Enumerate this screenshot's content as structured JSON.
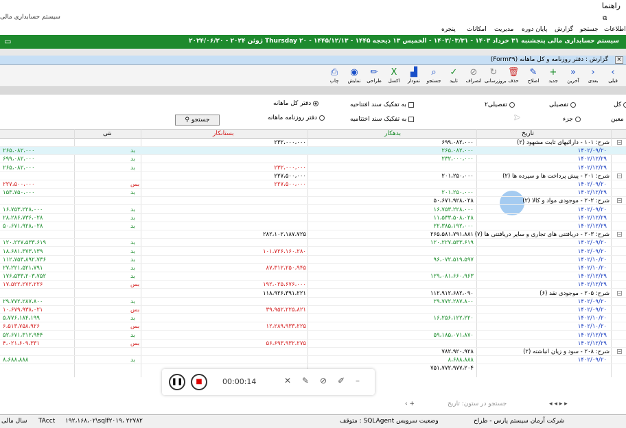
{
  "window": {
    "title": "راهنما",
    "subtitle": "سیستم حسابداری مالی"
  },
  "menu": [
    "اطلاعات",
    "جستجو",
    "گزارش",
    "پایان دوره",
    "مدیریت",
    "امکانات",
    "پنجره"
  ],
  "banner": {
    "text": "سیستم حسابداری مالی   پنجشنبه ۳۱ خرداد ۱۴۰۳ - ۱۴۰۳/۰۳/۳۱ - الخميس ۱۳ ذیحجه ۱۴۴۵ - ۱۴۴۵/۱۲/۱۳ - Thursday ۲۰ ژوئن ۲۰۲۴ - ۲۰۲۴/۰۶/۲۰"
  },
  "form": {
    "title": "گزارش : دفتر روزنامه و کل ماهانه (Form۳۹)"
  },
  "toolbar": [
    {
      "label": "قبلی",
      "icon": "arrow-left-icon",
      "glyph": "‹"
    },
    {
      "label": "بعدی",
      "icon": "arrow-right-icon",
      "glyph": "›"
    },
    {
      "label": "آخرین",
      "icon": "last-icon",
      "glyph": "»"
    },
    {
      "label": "جدید",
      "icon": "plus-icon",
      "glyph": "+"
    },
    {
      "label": "اصلاح",
      "icon": "pencil-icon",
      "glyph": "✎"
    },
    {
      "label": "حذف",
      "icon": "trash-icon",
      "glyph": "🗑"
    },
    {
      "label": "بروزرسانی",
      "icon": "refresh-icon",
      "glyph": "↻"
    },
    {
      "label": "انصراف",
      "icon": "cancel-icon",
      "glyph": "⊘"
    },
    {
      "label": "تایید",
      "icon": "check-icon",
      "glyph": "✓"
    },
    {
      "label": "جستجو",
      "icon": "search-icon",
      "glyph": "⌕"
    },
    {
      "label": "نمودار",
      "icon": "chart-icon",
      "glyph": "▟"
    },
    {
      "label": "اکسل",
      "icon": "excel-icon",
      "glyph": "X"
    },
    {
      "label": "طراحی",
      "icon": "design-icon",
      "glyph": "✏"
    },
    {
      "label": "نمایش",
      "icon": "eye-icon",
      "glyph": "◉"
    },
    {
      "label": "چاپ",
      "icon": "printer-icon",
      "glyph": "⎙"
    }
  ],
  "options": {
    "left_radio_kol": "کل",
    "left_radio_moein": "معین",
    "tafsili": "تفصیلی",
    "tafsili2": "تفصیلی۲",
    "joz": "جزء",
    "cb1": "به تفکیک سند افتتاحیه",
    "cb2": "به تفکیک سند اختتامیه",
    "r1": "دفتر کل ماهانه",
    "r2": "دفتر روزنامه ماهانه",
    "search_btn": "جستجو"
  },
  "headers": {
    "date": "تاریخ",
    "debit": "بدهکار",
    "credit": "بستانکار",
    "nature": "نتی",
    "balance": ""
  },
  "rows": [
    {
      "d": "شرح: ۱۰۱ - دارائیهای ثابت مشهود (۲)",
      "debit": "۶۹۹،۰۸۲،۰۰۰",
      "credit": "۲۳۲،۰۰۰،۰۰۰",
      "nat": "",
      "bal": "",
      "g": true
    },
    {
      "d": "۱۴۰۲/۰۹/۲۰",
      "debit": "۲۶۵،۰۸۲،۰۰۰",
      "credit": "",
      "nat": "بد",
      "bal": "۲۶۵،۰۸۲،۰۰۰",
      "sel": true
    },
    {
      "d": "۱۴۰۲/۱۲/۲۹",
      "debit": "۲۳۲،۰۰۰،۰۰۰",
      "credit": "",
      "nat": "بد",
      "bal": "۶۹۹،۰۸۲،۰۰۰"
    },
    {
      "d": "۱۴۰۲/۱۲/۲۹",
      "debit": "",
      "credit": "۲۳۲،۰۰۰،۰۰۰",
      "nat": "بد",
      "bal": "۲۶۵،۰۸۲،۰۰۰"
    },
    {
      "d": "شرح: ۲۰۱ - پیش پرداخت ها و سپرده ها (۲)",
      "debit": "۲۰۱،۲۵۰،۰۰۰",
      "credit": "۲۲۷،۵۰۰،۰۰۰",
      "nat": "",
      "bal": "",
      "g": true
    },
    {
      "d": "۱۴۰۲/۰۹/۲۰",
      "debit": "",
      "credit": "۲۲۷،۵۰۰،۰۰۰",
      "nat": "بس",
      "bal": "۲۲۷،۵۰۰،۰۰۰",
      "red": true
    },
    {
      "d": "۱۴۰۲/۱۲/۲۹",
      "debit": "۲۰۱،۲۵۰،۰۰۰",
      "credit": "",
      "nat": "بد",
      "bal": "۱۵۳،۷۵۰،۰۰۰"
    },
    {
      "d": "شرح: ۲۰۲ - موجودی مواد و کالا (۲)",
      "debit": "۵۰،۶۷۱،۹۲۸،۰۲۸",
      "credit": "",
      "nat": "",
      "bal": "",
      "g": true
    },
    {
      "d": "۱۴۰۲/۰۹/۲۰",
      "debit": "۱۶،۷۵۳،۲۲۸،۰۰۰",
      "credit": "",
      "nat": "بد",
      "bal": "۱۶،۷۵۳،۲۲۸،۰۰۰"
    },
    {
      "d": "۱۴۰۲/۱۲/۲۹",
      "debit": "۱۱،۵۳۳،۵۰۸،۰۲۸",
      "credit": "",
      "nat": "بد",
      "bal": "۲۸،۲۸۶،۷۳۶،۰۲۸"
    },
    {
      "d": "۱۴۰۲/۱۲/۲۹",
      "debit": "۲۲،۳۸۵،۱۹۲،۰۰۰",
      "credit": "",
      "nat": "بد",
      "bal": "۵۰،۶۷۱،۹۲۸،۰۲۸"
    },
    {
      "d": "شرح: ۲۰۳ - دریافتنی های تجاری و سایر دریافتنی ها (۷)",
      "debit": "۲۶۵،۵۸۱،۷۹۱،۸۸۱",
      "credit": "۲۸۲،۱۰۲،۱۸۷،۷۲۵",
      "nat": "",
      "bal": "",
      "g": true
    },
    {
      "d": "۱۴۰۲/۰۹/۲۰",
      "debit": "۱۲۰،۲۲۷،۵۳۳،۶۱۹",
      "credit": "",
      "nat": "بد",
      "bal": "۱۲۰،۲۲۷،۵۳۳،۶۱۹"
    },
    {
      "d": "۱۴۰۲/۰۹/۲۰",
      "debit": "",
      "credit": "۱۰۱،۷۲۶،۱۶۰،۲۸۰",
      "nat": "بد",
      "bal": "۱۸،۶۸۱،۳۷۳،۱۳۹"
    },
    {
      "d": "۱۴۰۲/۱۰/۲۰",
      "debit": "۹۶،۰۷۲،۵۱۹،۵۹۷",
      "credit": "",
      "nat": "بد",
      "bal": "۱۱۲،۷۵۳،۸۹۲،۷۳۶"
    },
    {
      "d": "۱۴۰۲/۱۰/۲۰",
      "debit": "",
      "credit": "۸۷،۳۱۲،۲۵۰،۹۴۵",
      "nat": "بد",
      "bal": "۲۷،۲۲۱،۵۲۱،۷۹۱"
    },
    {
      "d": "۱۴۰۲/۱۲/۲۹",
      "debit": "۱۲۹،۰۸۱،۶۶۰،۹۶۳",
      "credit": "",
      "nat": "بد",
      "bal": "۱۷۶،۵۳۳،۲۰۳،۷۵۲"
    },
    {
      "d": "۱۴۰۲/۱۲/۲۹",
      "debit": "",
      "credit": "۱۹۲،۰۲۵،۶۷۶،۰۰۰",
      "nat": "بس",
      "bal": "۱۷،۵۲۲،۲۷۲،۲۲۶",
      "red": true
    },
    {
      "d": "شرح: ۲۰۵ - موجودی نقد (۶)",
      "debit": "۱۱۲،۹۱۲،۶۸۲،۰۹۰",
      "credit": "۱۱۸،۹۲۶،۳۹۱،۲۲۱",
      "nat": "",
      "bal": "",
      "g": true
    },
    {
      "d": "۱۴۰۲/۰۹/۲۰",
      "debit": "۲۹،۷۷۲،۲۸۷،۸۰۰",
      "credit": "",
      "nat": "بد",
      "bal": "۲۹،۷۷۲،۲۸۷،۸۰۰"
    },
    {
      "d": "۱۴۰۲/۰۹/۲۰",
      "debit": "",
      "credit": "۳۹،۹۵۲،۲۲۵،۸۲۱",
      "nat": "بس",
      "bal": "۱۰،۶۷۹،۹۳۸،۰۲۱",
      "red": true
    },
    {
      "d": "۱۴۰۲/۱۰/۲۰",
      "debit": "۱۶،۲۵۶،۱۲۲،۲۲۰",
      "credit": "",
      "nat": "بد",
      "bal": "۵،۷۷۶،۱۸۴،۱۹۹"
    },
    {
      "d": "۱۴۰۲/۱۰/۲۰",
      "debit": "",
      "credit": "۱۲،۲۸۹،۹۳۳،۲۲۵",
      "nat": "بس",
      "bal": "۶،۵۱۳،۷۵۸،۹۲۶",
      "red": true
    },
    {
      "d": "۱۴۰۲/۱۲/۲۹",
      "debit": "۵۹،۱۸۵،۰۷۱،۸۷۰",
      "credit": "",
      "nat": "بد",
      "bal": "۵۲،۶۷۱،۳۱۲،۹۴۴"
    },
    {
      "d": "۱۴۰۲/۱۲/۲۹",
      "debit": "",
      "credit": "۵۶،۶۹۳،۹۳۲،۲۷۵",
      "nat": "بس",
      "bal": "۴،۰۲۱،۶۰۹،۳۳۱",
      "red": true
    },
    {
      "d": "شرح: ۲۰۸ - سود و زیان انباشته (۲)",
      "debit": "۷۸۲،۹۲۰،۹۲۸",
      "credit": "",
      "nat": "",
      "bal": "",
      "g": true
    },
    {
      "d": "۱۴۰۲/۰۹/۲۰",
      "debit": "۸،۶۸۸،۸۸۸",
      "credit": "",
      "nat": "بد",
      "bal": "۸،۶۸۸،۸۸۸"
    }
  ],
  "footer_sum": "۷۵۱،۷۷۲،۹۷۷،۲۰۴",
  "recorder": {
    "time": "00:00:14"
  },
  "nav": {
    "search_placeholder": "جستجو در ستون: تاریخ"
  },
  "status": {
    "company": "شرکت آرمان سیستم پارس - طراح",
    "service": "متوقف : SQLAgent وضعیت سرویس",
    "server": "۱۹۲،۱۶۸،۰۲\\sqlf۲۰۱۹، ۲۲۷۸۲",
    "db": "TAcct",
    "year": "سال مالی"
  }
}
